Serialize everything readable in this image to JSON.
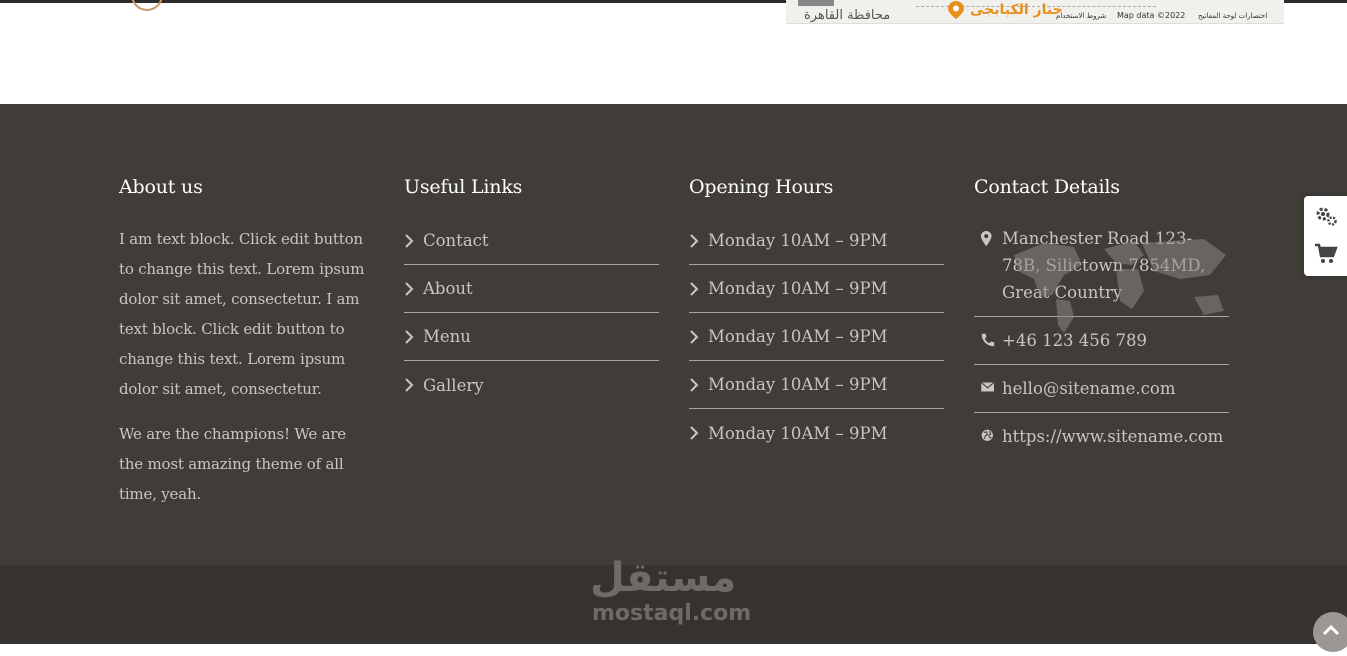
{
  "map": {
    "governorate": "محافظة القاهرة",
    "place_name": "جنار الكبابجى",
    "terms": "شروط الاستخدام",
    "map_data": "Map data ©2022",
    "shortcuts": "اختصارات لوحة المفاتيح"
  },
  "about": {
    "title": "About us",
    "paragraph_1": "I am text block. Click edit button to change this text. Lorem ipsum dolor sit amet, consectetur. I am text block. Click edit button to change this text. Lorem ipsum dolor sit amet, consectetur.",
    "paragraph_2": "We are the champions! We are the most amazing theme of all time, yeah."
  },
  "links": {
    "title": "Useful Links",
    "items": [
      {
        "label": "Contact"
      },
      {
        "label": "About"
      },
      {
        "label": "Menu"
      },
      {
        "label": "Gallery"
      }
    ]
  },
  "hours": {
    "title": "Opening Hours",
    "items": [
      {
        "label": "Monday 10AM – 9PM"
      },
      {
        "label": "Monday 10AM – 9PM"
      },
      {
        "label": "Monday 10AM – 9PM"
      },
      {
        "label": "Monday 10AM – 9PM"
      },
      {
        "label": "Monday 10AM – 9PM"
      }
    ]
  },
  "contact": {
    "title": "Contact Details",
    "address": "Manchester Road 123-78B, Silictown 7854MD, Great Country",
    "phone": "+46 123 456 789",
    "email": "hello@sitename.com",
    "website": "https://www.sitename.com"
  },
  "watermark": {
    "arabic": "مستقل",
    "latin": "mostaql.com"
  },
  "colors": {
    "footer_bg": "#403c38",
    "bottom_bg": "#36322f",
    "accent_pin": "#e8901c"
  },
  "icons": {
    "list_chevron": "chevron-right-icon",
    "address": "map-marker-icon",
    "phone": "phone-icon",
    "email": "envelope-icon",
    "website": "globe-icon",
    "settings": "gears-icon",
    "cart": "cart-icon",
    "scroll_top": "chevron-up-icon"
  }
}
